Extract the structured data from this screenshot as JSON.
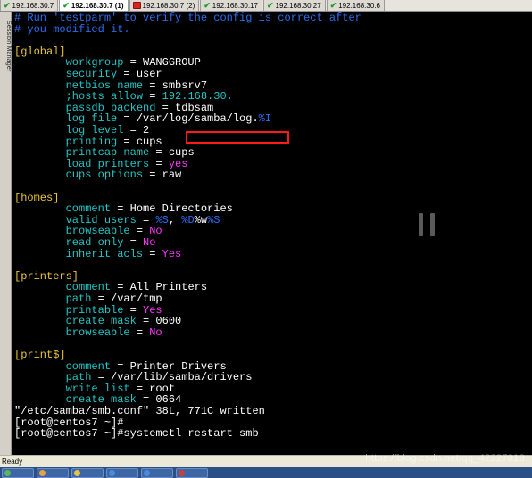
{
  "tabs": [
    {
      "label": "192.168.30.7",
      "status": "connected",
      "active": false
    },
    {
      "label": "192.168.30.7 (1)",
      "status": "connected",
      "active": true
    },
    {
      "label": "192.168.30.7 (2)",
      "status": "error",
      "active": false
    },
    {
      "label": "192.168.30.17",
      "status": "connected",
      "active": false
    },
    {
      "label": "192.168.30.27",
      "status": "connected",
      "active": false
    },
    {
      "label": "192.168.30.6",
      "status": "connected",
      "active": false
    }
  ],
  "gutter": {
    "label": "Session Manager"
  },
  "terminal": {
    "lines": [
      [
        {
          "t": "# Run 'testparm' to verify the config is correct after",
          "c": "cmt"
        }
      ],
      [
        {
          "t": "# you modified it.",
          "c": "cmt"
        }
      ],
      [],
      [
        {
          "t": "[global]",
          "c": "sec"
        }
      ],
      [
        {
          "t": "        workgroup",
          "c": "key"
        },
        {
          "t": " = WANGGROUP",
          "c": "val"
        }
      ],
      [
        {
          "t": "        security",
          "c": "key"
        },
        {
          "t": " = user",
          "c": "val"
        }
      ],
      [
        {
          "t": "        netbios name",
          "c": "key"
        },
        {
          "t": " = smbsrv7",
          "c": "val"
        }
      ],
      [
        {
          "t": "        ;hosts allow",
          "c": "key"
        },
        {
          "t": " = ",
          "c": "val"
        },
        {
          "t": "192.168.30.",
          "c": "key"
        }
      ],
      [
        {
          "t": "        passdb backend",
          "c": "key"
        },
        {
          "t": " = tdbsam",
          "c": "val"
        }
      ],
      [
        {
          "t": "        log file",
          "c": "key"
        },
        {
          "t": " = /var/log/samba/log.",
          "c": "val"
        },
        {
          "t": "%I",
          "c": "blu"
        }
      ],
      [
        {
          "t": "        log level",
          "c": "key"
        },
        {
          "t": " = 2",
          "c": "val"
        }
      ],
      [
        {
          "t": "        printing",
          "c": "key"
        },
        {
          "t": " = cups",
          "c": "val"
        }
      ],
      [
        {
          "t": "        printcap name",
          "c": "key"
        },
        {
          "t": " = cups",
          "c": "val"
        }
      ],
      [
        {
          "t": "        load printers",
          "c": "key"
        },
        {
          "t": " = ",
          "c": "val"
        },
        {
          "t": "yes",
          "c": "mag"
        }
      ],
      [
        {
          "t": "        cups options",
          "c": "key"
        },
        {
          "t": " = raw",
          "c": "val"
        }
      ],
      [],
      [
        {
          "t": "[homes]",
          "c": "sec"
        }
      ],
      [
        {
          "t": "        comment",
          "c": "key"
        },
        {
          "t": " = Home Directories",
          "c": "val"
        }
      ],
      [
        {
          "t": "        valid users",
          "c": "key"
        },
        {
          "t": " = ",
          "c": "val"
        },
        {
          "t": "%S",
          "c": "blu"
        },
        {
          "t": ", ",
          "c": "val"
        },
        {
          "t": "%D",
          "c": "blu"
        },
        {
          "t": "%w",
          "c": "val"
        },
        {
          "t": "%S",
          "c": "blu"
        }
      ],
      [
        {
          "t": "        browseable",
          "c": "key"
        },
        {
          "t": " = ",
          "c": "val"
        },
        {
          "t": "No",
          "c": "mag"
        }
      ],
      [
        {
          "t": "        read only",
          "c": "key"
        },
        {
          "t": " = ",
          "c": "val"
        },
        {
          "t": "No",
          "c": "mag"
        }
      ],
      [
        {
          "t": "        inherit acls",
          "c": "key"
        },
        {
          "t": " = ",
          "c": "val"
        },
        {
          "t": "Yes",
          "c": "mag"
        }
      ],
      [],
      [
        {
          "t": "[printers]",
          "c": "sec"
        }
      ],
      [
        {
          "t": "        comment",
          "c": "key"
        },
        {
          "t": " = All Printers",
          "c": "val"
        }
      ],
      [
        {
          "t": "        path",
          "c": "key"
        },
        {
          "t": " = /var/tmp",
          "c": "val"
        }
      ],
      [
        {
          "t": "        printable",
          "c": "key"
        },
        {
          "t": " = ",
          "c": "val"
        },
        {
          "t": "Yes",
          "c": "mag"
        }
      ],
      [
        {
          "t": "        create mask",
          "c": "key"
        },
        {
          "t": " = 0600",
          "c": "val"
        }
      ],
      [
        {
          "t": "        browseable",
          "c": "key"
        },
        {
          "t": " = ",
          "c": "val"
        },
        {
          "t": "No",
          "c": "mag"
        }
      ],
      [],
      [
        {
          "t": "[print$]",
          "c": "sec"
        }
      ],
      [
        {
          "t": "        comment",
          "c": "key"
        },
        {
          "t": " = Printer Drivers",
          "c": "val"
        }
      ],
      [
        {
          "t": "        path",
          "c": "key"
        },
        {
          "t": " = /var/lib/samba/drivers",
          "c": "val"
        }
      ],
      [
        {
          "t": "        write list",
          "c": "key"
        },
        {
          "t": " = root",
          "c": "val"
        }
      ],
      [
        {
          "t": "        create mask",
          "c": "key"
        },
        {
          "t": " = 0664",
          "c": "val"
        }
      ],
      [
        {
          "t": "\"/etc/samba/smb.conf\" 38L, 771C written",
          "c": "val"
        }
      ],
      [
        {
          "t": "[root@centos7 ~]#",
          "c": "val"
        }
      ],
      [
        {
          "t": "[root@centos7 ~]#systemctl restart smb",
          "c": "val"
        }
      ]
    ]
  },
  "statusbar": {
    "text": "Ready"
  },
  "watermark": {
    "text": "https://blog.csdn.net/qq_42227818"
  },
  "colors": {
    "comment": "#2b6cf0",
    "key": "#22c6c6",
    "section": "#e8c53a",
    "value": "#ffffff",
    "keyword": "#ff39ff",
    "highlight_box": "#ff1a1a"
  }
}
